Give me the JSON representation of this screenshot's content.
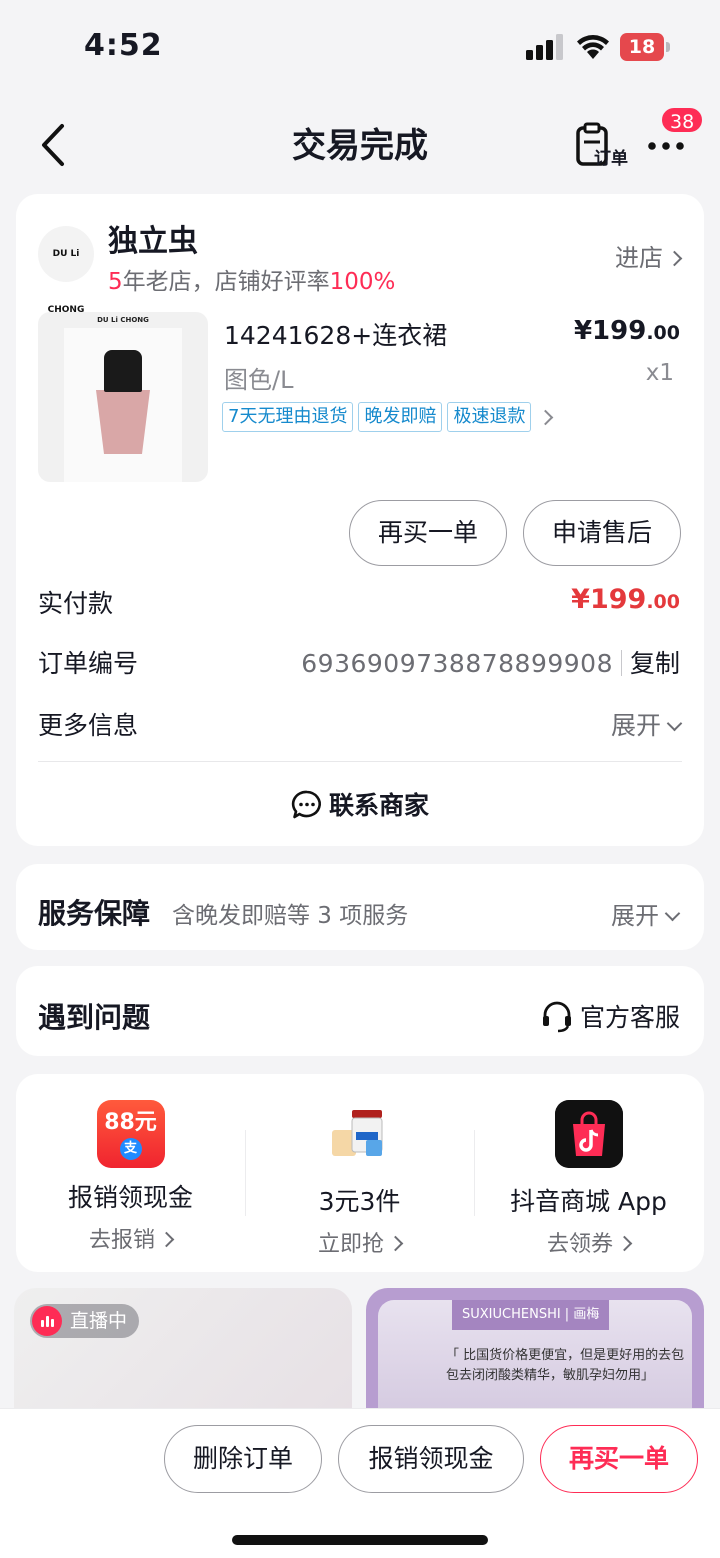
{
  "status_bar": {
    "time": "4:52",
    "battery": "18"
  },
  "nav": {
    "title": "交易完成",
    "order_label": "订单",
    "badge": "38"
  },
  "shop": {
    "logo_text": "DU Li CHONG",
    "name": "独立虫",
    "years_number": "5",
    "years_text": "年老店，店铺好评率",
    "rating": "100%",
    "enter_label": "进店"
  },
  "product": {
    "image_brand": "DU Li CHONG",
    "title": "14241628+连衣裙",
    "price_main": "¥199",
    "price_decimal": ".00",
    "spec": "图色/L",
    "quantity": "x1",
    "tags": [
      "7天无理由退货",
      "晚发即赔",
      "极速退款"
    ]
  },
  "actions": {
    "buy_again": "再买一单",
    "after_sale": "申请售后"
  },
  "payment": {
    "label": "实付款",
    "amount_main": "¥199",
    "amount_decimal": ".00"
  },
  "order_number": {
    "label": "订单编号",
    "value": "6936909738878899908",
    "copy_label": "复制"
  },
  "more_info": {
    "label": "更多信息",
    "expand_label": "展开"
  },
  "contact_label": "联系商家",
  "service": {
    "title": "服务保障",
    "subtitle": "含晚发即赔等 3 项服务",
    "expand_label": "展开"
  },
  "problem": {
    "title": "遇到问题",
    "customer_service": "官方客服"
  },
  "promos": [
    {
      "icon_text": "88元",
      "title": "报销领现金",
      "action": "去报销"
    },
    {
      "title": "3元3件",
      "action": "立即抢"
    },
    {
      "title": "抖音商城 App",
      "action": "去领券"
    }
  ],
  "feed": {
    "live_label": "直播中",
    "brand_tag": "SUXIUCHENSHI | 画梅",
    "ad_text": "「 比国货价格更便宜，但是更好用的去包包去闭闭酸类精华，敏肌孕妇勿用」"
  },
  "bottom_bar": {
    "delete_order": "删除订单",
    "reimburse": "报销领现金",
    "buy_again": "再买一单"
  },
  "colors": {
    "accent_red": "#fe2c55",
    "price_red": "#e4393c",
    "tag_blue": "#168acd",
    "background": "#f4f4f6"
  }
}
